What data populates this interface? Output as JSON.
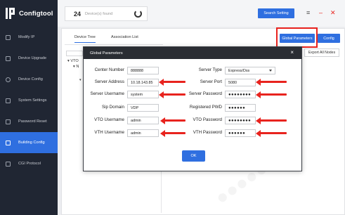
{
  "app": {
    "title": "Configtool"
  },
  "sidebar": {
    "items": [
      {
        "label": "Modify IP",
        "icon": "modify-ip-icon",
        "active": false
      },
      {
        "label": "Device Upgrade",
        "icon": "upgrade-icon",
        "active": false
      },
      {
        "label": "Device Config",
        "icon": "gear-icon",
        "active": false
      },
      {
        "label": "System Settings",
        "icon": "settings-icon",
        "active": false
      },
      {
        "label": "Password Reset",
        "icon": "lock-icon",
        "active": false
      },
      {
        "label": "Building Config",
        "icon": "building-icon",
        "active": true
      },
      {
        "label": "CGI Protocol",
        "icon": "protocol-icon",
        "active": false
      }
    ]
  },
  "topbar": {
    "device_count": "24",
    "device_count_label": "Device(s) found",
    "search_setting_label": "Search Setting"
  },
  "main": {
    "tabs": [
      {
        "label": "Device Tree",
        "active": true
      },
      {
        "label": "Association List",
        "active": false
      }
    ],
    "global_parameters_label": "Global Parameters",
    "config_label": "Config",
    "export_label": "Export All Nodes",
    "tree": {
      "root": "VTO",
      "child": "N"
    }
  },
  "dialog": {
    "title": "Global Parameters",
    "fields": {
      "center_number": {
        "label": "Center Number",
        "value": "888888"
      },
      "server_type": {
        "label": "Server Type",
        "value": "Express/Dss"
      },
      "server_address": {
        "label": "Server Address",
        "value": "10.18.143.85"
      },
      "server_port": {
        "label": "Server Port",
        "value": "5080"
      },
      "server_username": {
        "label": "Server Username",
        "value": "system"
      },
      "server_password": {
        "label": "Server Password",
        "value": "●●●●●●●●"
      },
      "sip_domain": {
        "label": "Sip Domain",
        "value": "VDP"
      },
      "registered_pwd": {
        "label": "Registered PWD",
        "value": "●●●●●●"
      },
      "vto_username": {
        "label": "VTO Username",
        "value": "admin"
      },
      "vto_password": {
        "label": "VTO Password",
        "value": "●●●●●●●●"
      },
      "vth_username": {
        "label": "VTH Username",
        "value": "admin"
      },
      "vth_password": {
        "label": "VTH Password",
        "value": "●●●●●●"
      }
    },
    "ok_label": "OK"
  },
  "colors": {
    "accent": "#2f6fe0",
    "sidebar_bg": "#202633",
    "annotation": "#e8231e"
  }
}
